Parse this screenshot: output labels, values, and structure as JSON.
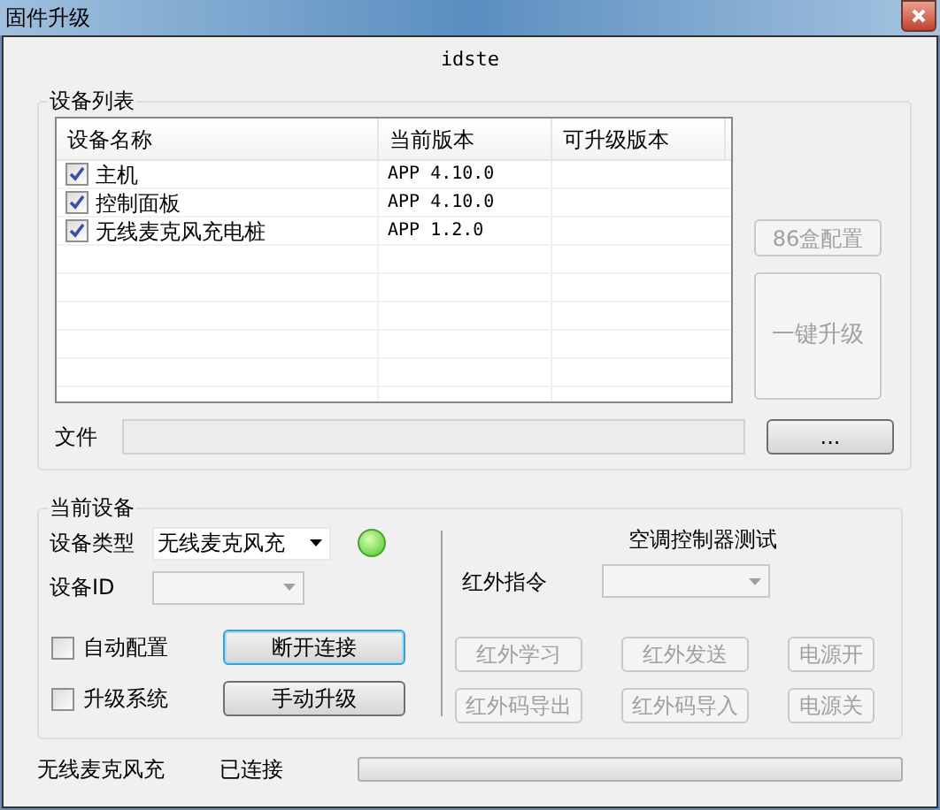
{
  "window": {
    "title": "固件升级"
  },
  "header": "idste",
  "device_list": {
    "title": "设备列表",
    "columns": [
      "设备名称",
      "当前版本",
      "可升级版本"
    ],
    "rows": [
      {
        "name": "主机",
        "version": "APP 4.10.0",
        "checked": true
      },
      {
        "name": "控制面板",
        "version": "APP 4.10.0",
        "checked": true
      },
      {
        "name": "无线麦克风充电桩",
        "version": "APP 1.2.0",
        "checked": true
      }
    ],
    "buttons": [
      {
        "label": "86盒配置",
        "disabled": true
      },
      {
        "label": "一键升级",
        "disabled": true
      }
    ],
    "file": {
      "label": "文件",
      "disabled": true,
      "browse": "..."
    }
  },
  "current_device": {
    "title": "当前设备",
    "type": {
      "label": "设备类型",
      "value": "无线麦克风充",
      "disabled": false
    },
    "status_light": {
      "on": true
    },
    "id": {
      "label": "设备ID",
      "disabled": true
    },
    "options": [
      {
        "label": "自动配置",
        "checked": false,
        "button": "断开连接",
        "focused": true
      },
      {
        "label": "升级系统",
        "checked": false,
        "button": "手动升级",
        "focused": false
      }
    ],
    "ac_test": {
      "title": "空调控制器测试",
      "ir_label": "红外指令",
      "ir_disabled": true,
      "buttons": [
        {
          "label": "红外学习",
          "disabled": true
        },
        {
          "label": "红外发送",
          "disabled": true
        },
        {
          "label": "电源开",
          "disabled": true
        },
        {
          "label": "红外码导出",
          "disabled": true
        },
        {
          "label": "红外码导入",
          "disabled": true
        },
        {
          "label": "电源关",
          "disabled": true
        }
      ]
    }
  },
  "status_bar": {
    "device": "无线麦克风充",
    "state": "已连接",
    "level": 0
  }
}
